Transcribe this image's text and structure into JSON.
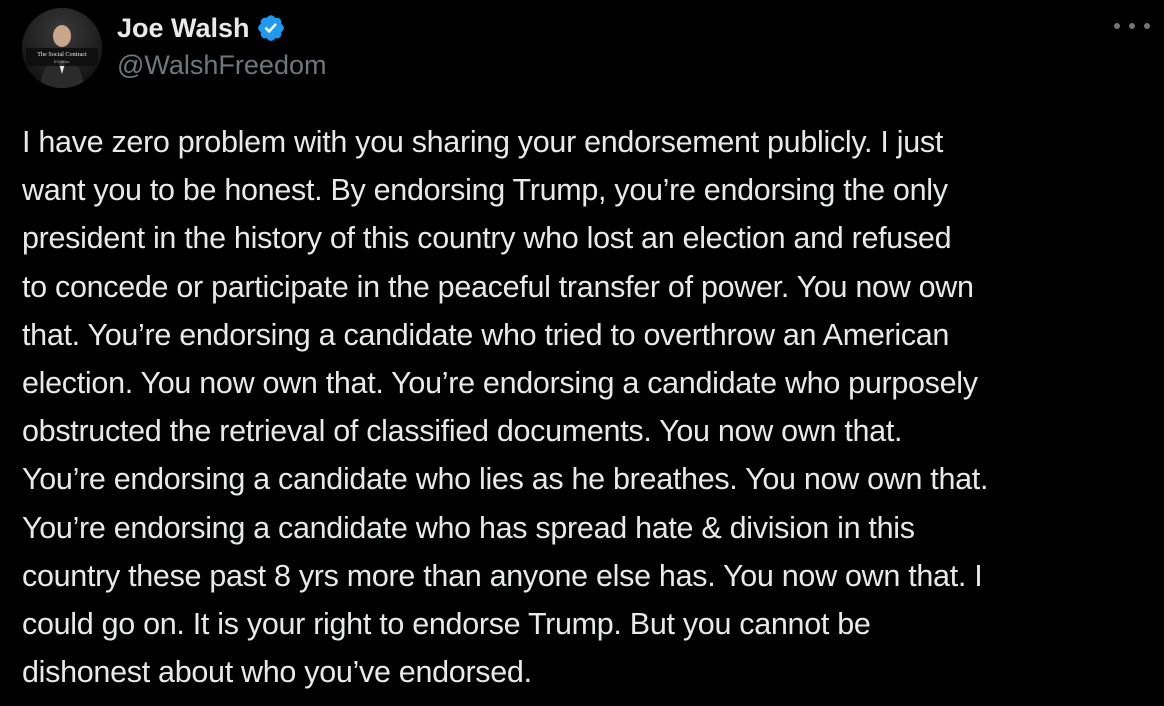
{
  "author": {
    "display_name": "Joe Walsh",
    "handle": "@WalshFreedom",
    "verified": true,
    "avatar_caption": "The Social Contract",
    "avatar_subcaption": "It's on us.",
    "avatar_alt": "Joe Walsh profile photo"
  },
  "menu_icon": "more-horizontal-icon",
  "colors": {
    "background": "#000000",
    "text": "#e7e9ea",
    "secondary_text": "#71767b",
    "verified_blue": "#1d9bf0"
  },
  "tweet": {
    "lines": [
      "I have zero problem with you sharing your endorsement publicly. I just",
      "want you to be honest. By endorsing Trump, you’re endorsing the only",
      "president in the history of this country who lost an election and refused",
      "to concede or participate in the peaceful transfer of power. You now own",
      "that. You’re endorsing a candidate who tried to overthrow an American",
      "election. You now own that. You’re endorsing a candidate who purposely",
      "obstructed the retrieval of classified documents. You now own that.",
      "You’re endorsing a candidate who lies as he breathes. You now own that.",
      "You’re endorsing a candidate who has spread hate & division in this",
      "country these past 8 yrs more than anyone else has. You now own that. I",
      "could go on. It is your right to endorse Trump. But you cannot be",
      "dishonest about who you’ve endorsed."
    ]
  }
}
